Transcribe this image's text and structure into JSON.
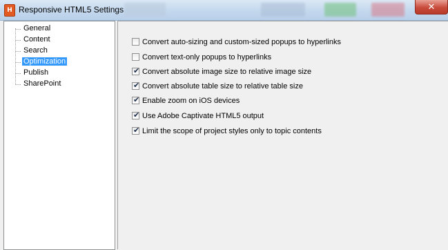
{
  "window": {
    "title": "Responsive HTML5 Settings",
    "app_icon_glyph": "H",
    "close_glyph": "✕"
  },
  "tree": {
    "items": [
      {
        "label": "General",
        "selected": false
      },
      {
        "label": "Content",
        "selected": false
      },
      {
        "label": "Search",
        "selected": false
      },
      {
        "label": "Optimization",
        "selected": true
      },
      {
        "label": "Publish",
        "selected": false
      },
      {
        "label": "SharePoint",
        "selected": false
      }
    ]
  },
  "options": [
    {
      "label": "Convert auto-sizing and custom-sized popups to hyperlinks",
      "checked": false
    },
    {
      "label": "Convert text-only popups to hyperlinks",
      "checked": false
    },
    {
      "label": "Convert absolute image size to relative image size",
      "checked": true
    },
    {
      "label": "Convert absolute table size to relative table size",
      "checked": true
    },
    {
      "label": "Enable zoom on iOS devices",
      "checked": true
    },
    {
      "label": "Use Adobe Captivate HTML5 output",
      "checked": true
    },
    {
      "label": "Limit the scope of project styles only to topic contents",
      "checked": true
    }
  ],
  "colors": {
    "selection": "#3399ff",
    "checkmark": "#1c2e4a",
    "close_button": "#c94b3b"
  },
  "icons": {
    "app": "robohelp-app-icon",
    "close": "close-icon",
    "check": "checkmark-icon"
  }
}
